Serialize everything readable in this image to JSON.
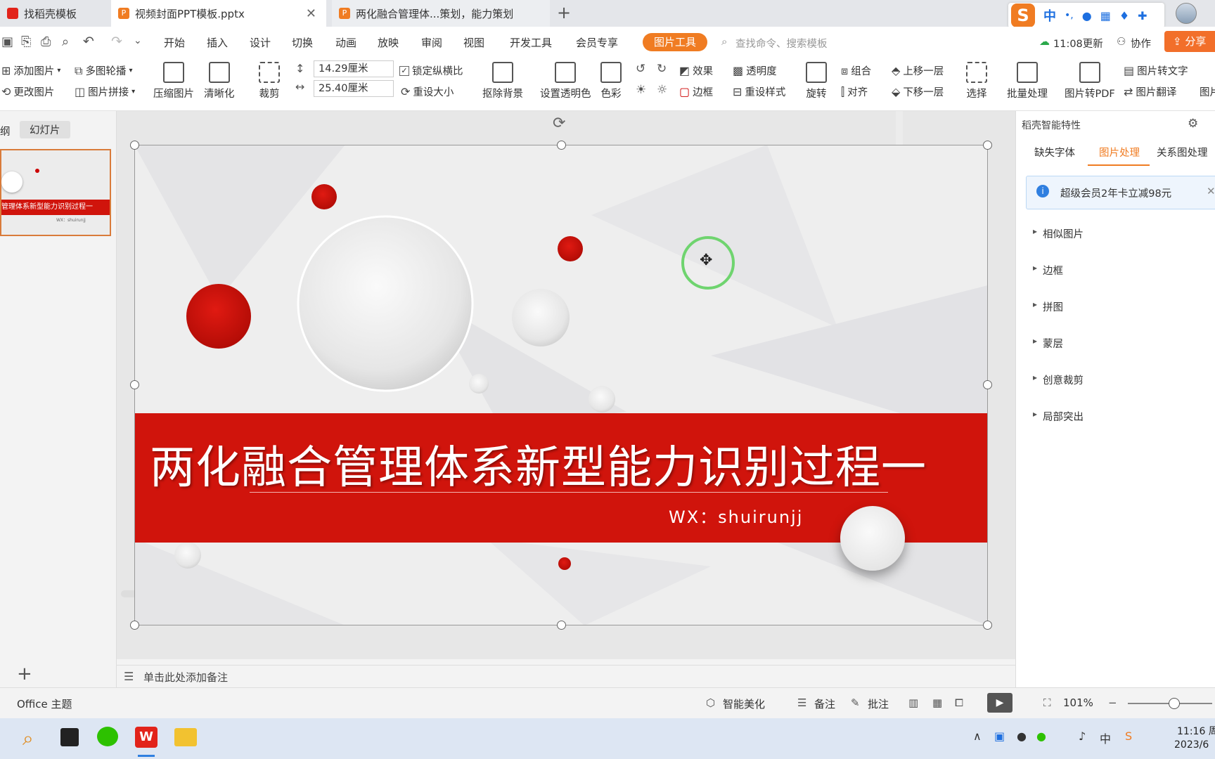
{
  "tabs": [
    {
      "label": "找稻壳模板",
      "color": "#e2231a"
    },
    {
      "label": "视频封面PPT模板.pptx",
      "color": "#f07c22"
    },
    {
      "label": "两化融合管理体...策划，能力策划",
      "color": "#f07c22"
    }
  ],
  "new_tab": "+",
  "ime": {
    "logo": "S",
    "mode": "中",
    "punct": "•,"
  },
  "menu": {
    "items": [
      "开始",
      "插入",
      "设计",
      "切换",
      "动画",
      "放映",
      "审阅",
      "视图",
      "开发工具",
      "会员专享"
    ],
    "active_tool": "图片工具",
    "search_placeholder": "查找命令、搜索模板",
    "sync": "11:08更新",
    "collab": "协作",
    "share": "分享"
  },
  "ribbon": {
    "add_picture": "添加图片",
    "carousel": "多图轮播",
    "change_picture": "更改图片",
    "picture_splice": "图片拼接",
    "compress": "压缩图片",
    "sharpen": "清晰化",
    "crop": "裁剪",
    "height": "14.29厘米",
    "width": "25.40厘米",
    "lock_ratio": "锁定纵横比",
    "reset_size": "重设大小",
    "remove_bg": "抠除背景",
    "set_transparent": "设置透明色",
    "color": "色彩",
    "effect": "效果",
    "transparency": "透明度",
    "border": "边框",
    "reset_style": "重设样式",
    "rotate": "旋转",
    "group": "组合",
    "align": "对齐",
    "bring_forward": "上移一层",
    "send_backward": "下移一层",
    "select": "选择",
    "batch": "批量处理",
    "to_pdf": "图片转PDF",
    "to_text": "图片转文字",
    "translate": "图片翻译",
    "more": "图片"
  },
  "left_panel": {
    "tab_outline": "纲",
    "tab_slides": "幻灯片",
    "thumb_title": "管理体系新型能力识别过程一",
    "thumb_sub": "WX：shuirunjj",
    "add": "+"
  },
  "slide": {
    "title": "两化融合管理体系新型能力识别过程一",
    "subtitle": "WX：shuirunjj",
    "accent": "#d0140c"
  },
  "notes_placeholder": "单击此处添加备注",
  "right_panel": {
    "header": "稻壳智能特性",
    "tabs": [
      "缺失字体",
      "图片处理",
      "关系图处理"
    ],
    "promo": "超级会员2年卡立减98元",
    "sections": [
      "相似图片",
      "边框",
      "拼图",
      "蒙层",
      "创意裁剪",
      "局部突出"
    ],
    "accent": "#f07c22"
  },
  "status": {
    "theme": "Office 主题",
    "beautify": "智能美化",
    "notes": "备注",
    "comments": "批注",
    "zoom": "101%",
    "zoom_level": 0.55
  },
  "taskbar": {
    "time": "11:16 周",
    "date": "2023/6"
  }
}
